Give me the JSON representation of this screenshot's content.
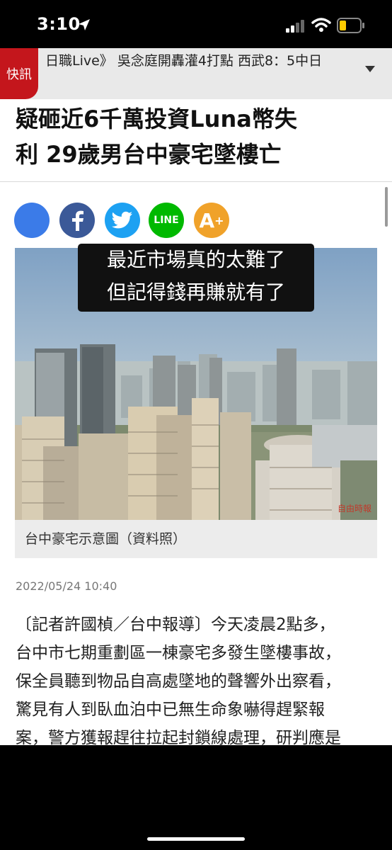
{
  "status_bar": {
    "time": "3:10"
  },
  "breaking": {
    "badge": "快訊",
    "text": "日職Live》 吳念庭開轟灌4打點 西武8：5中日"
  },
  "article": {
    "headline_line1": "疑砸近6千萬投資Luna幣失",
    "headline_line2": "利 29歲男台中豪宅墜樓亡",
    "share": {
      "line_label": "LINE",
      "font_label": "A",
      "font_sup": "+"
    },
    "image_overlay": {
      "line1": "最近市場真的太難了",
      "line2": "但記得錢再賺就有了"
    },
    "watermark": "自由時報",
    "caption": "台中豪宅示意圖（資料照）",
    "date": "2022/05/24 10:40",
    "body_lines": [
      "〔記者許國楨／台中報導〕今天凌晨2點多，",
      "台中市七期重劃區一棟豪宅多發生墜樓事故，",
      "保全員聽到物品自高處墜地的聲響外出察看，",
      "驚見有人到臥血泊中已無生命象嚇得趕緊報",
      "案，警方獲報趕往拉起封鎖線處理，研判應是"
    ]
  },
  "colors": {
    "badge_red": "#c4161c",
    "facebook": "#3b5998",
    "twitter": "#1da1f2",
    "line": "#00b900",
    "font_size": "#f0a22a"
  }
}
